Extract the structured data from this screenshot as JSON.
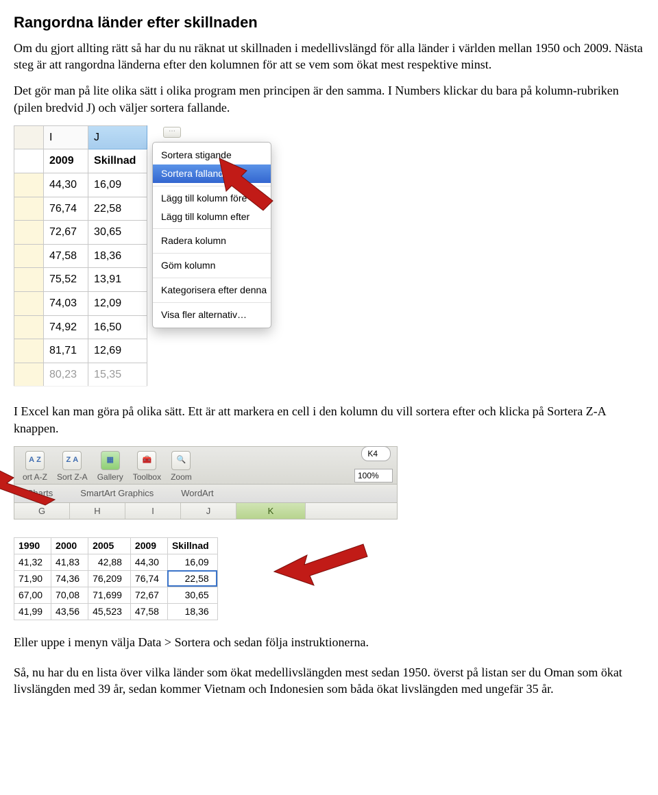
{
  "heading": "Rangordna länder efter skillnaden",
  "p1": "Om du gjort allting rätt så har du nu räknat ut skillnaden i medellivslängd för alla länder i världen mellan 1950 och 2009. Nästa steg är att rangordna länderna efter den kolumnen för att se vem som ökat mest respektive minst.",
  "p2": "Det gör man på lite olika sätt i olika program men principen är den samma. I Numbers klickar du bara på kolumn-rubriken (pilen bredvid J) och väljer sortera fallande.",
  "p3": "I Excel kan man göra på olika sätt. Ett är att markera en cell i den kolumn du vill sortera efter och klicka på Sortera Z-A knappen.",
  "p4": "Eller uppe i menyn välja Data > Sortera och sedan följa instruktionerna.",
  "p5": "Så, nu har du en lista över vilka länder som ökat medellivslängden mest sedan 1950. överst på listan ser du Oman som ökat livslängden med 39 år, sedan kommer Vietnam och Indonesien som båda ökat livslängden med ungefär 35 år.",
  "numbers": {
    "col_letters": [
      "I",
      "J"
    ],
    "head1": "2009",
    "head2": "Skillnad",
    "rows": [
      [
        "44,30",
        "16,09"
      ],
      [
        "76,74",
        "22,58"
      ],
      [
        "72,67",
        "30,65"
      ],
      [
        "47,58",
        "18,36"
      ],
      [
        "75,52",
        "13,91"
      ],
      [
        "74,03",
        "12,09"
      ],
      [
        "74,92",
        "16,50"
      ],
      [
        "81,71",
        "12,69"
      ],
      [
        "80,23",
        "15,35"
      ]
    ]
  },
  "ctx": {
    "items": [
      "Sortera stigande",
      "Sortera fallande",
      "Lägg till kolumn före",
      "Lägg till kolumn efter",
      "Radera kolumn",
      "Göm kolumn",
      "Kategorisera efter denna",
      "Visa fler alternativ…"
    ],
    "hl_index": 1
  },
  "excel_toolbar": {
    "btns": [
      "ort A-Z",
      "Sort Z-A",
      "Gallery",
      "Toolbox",
      "Zoom"
    ],
    "zoom": "100%",
    "namebox": "K4",
    "ribbon": [
      "Charts",
      "SmartArt Graphics",
      "WordArt"
    ],
    "cols": [
      "G",
      "H",
      "I",
      "J",
      "K"
    ],
    "sel_col": "K"
  },
  "mini": {
    "headers": [
      "1990",
      "2000",
      "2005",
      "2009",
      "Skillnad"
    ],
    "rows": [
      [
        "41,32",
        "41,83",
        "42,88",
        "44,30",
        "16,09"
      ],
      [
        "71,90",
        "74,36",
        "76,209",
        "76,74",
        "22,58"
      ],
      [
        "67,00",
        "70,08",
        "71,699",
        "72,67",
        "30,65"
      ],
      [
        "41,99",
        "43,56",
        "45,523",
        "47,58",
        "18,36"
      ]
    ]
  }
}
